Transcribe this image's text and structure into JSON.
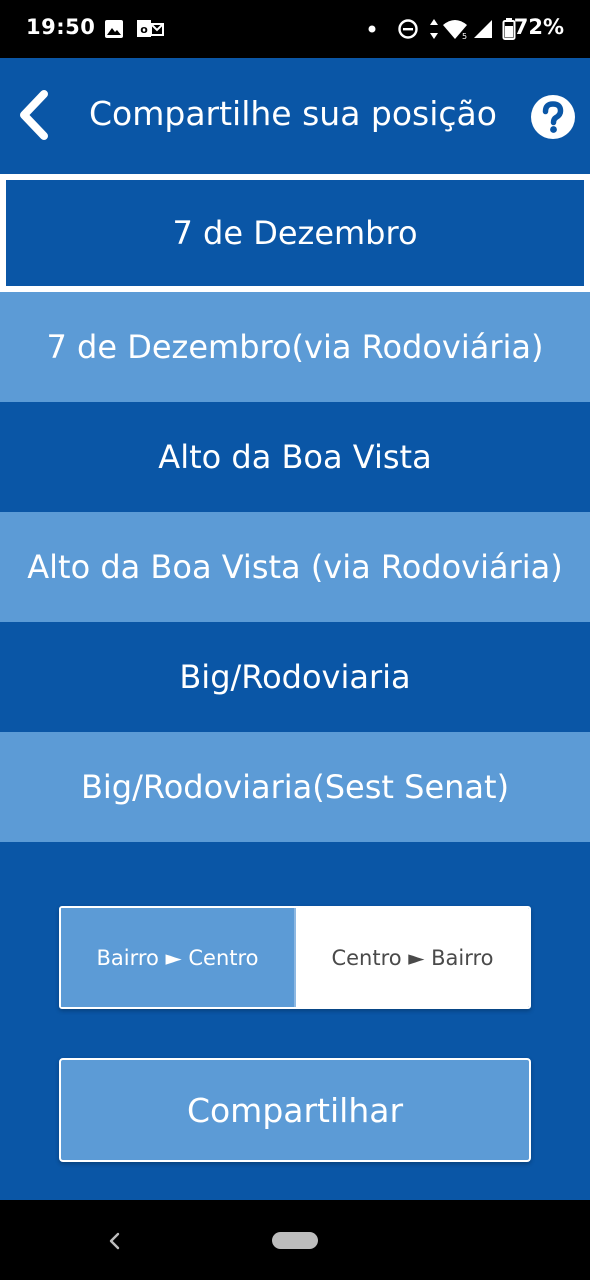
{
  "status_bar": {
    "time": "19:50",
    "battery": "72%",
    "icons": [
      "image-icon",
      "outlook-icon",
      "dot-icon",
      "dnd-icon",
      "data-arrows-icon",
      "wifi-icon",
      "signal-icon",
      "battery-icon"
    ]
  },
  "app_bar": {
    "title": "Compartilhe sua posição",
    "back_icon": "chevron-left-icon",
    "help_icon": "help-circle-icon"
  },
  "routes": {
    "selected_index": 0,
    "items": [
      {
        "label": "7 de Dezembro"
      },
      {
        "label": "7 de Dezembro(via Rodoviária)"
      },
      {
        "label": "Alto da Boa Vista"
      },
      {
        "label": "Alto da Boa Vista (via Rodoviária)"
      },
      {
        "label": "Big/Rodoviaria"
      },
      {
        "label": "Big/Rodoviaria(Sest Senat)"
      }
    ]
  },
  "direction": {
    "options": [
      {
        "label": "Bairro ► Centro",
        "active": true
      },
      {
        "label": "Centro ► Bairro",
        "active": false
      }
    ]
  },
  "share_button": {
    "label": "Compartilhar"
  },
  "colors": {
    "primary": "#0A56A6",
    "light": "#5C9BD6",
    "white": "#FFFFFF",
    "black": "#000000"
  }
}
